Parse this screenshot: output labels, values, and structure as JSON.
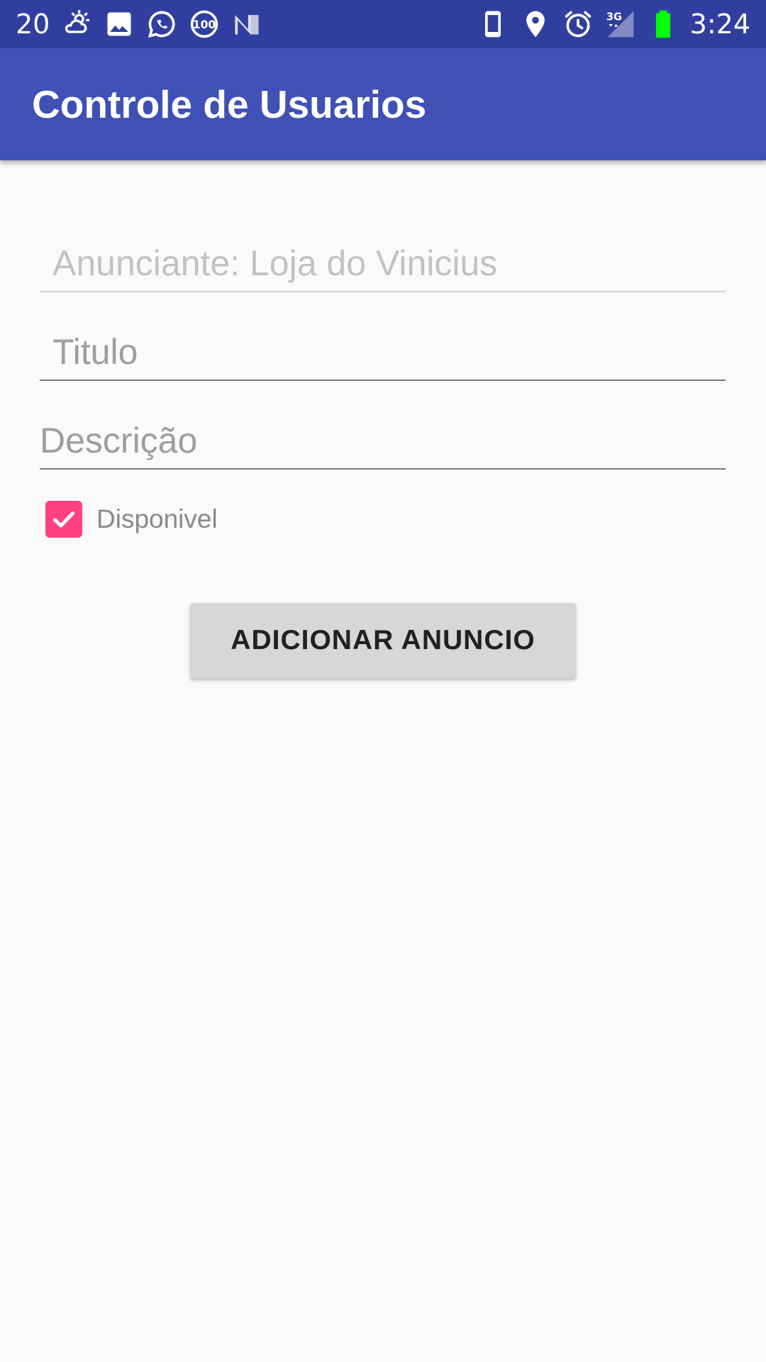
{
  "status_bar": {
    "left_number": "20",
    "left_icons": [
      "cloud-sun-icon",
      "gallery-image-icon",
      "whatsapp-icon",
      "hundred-badge-icon",
      "n-logo-icon"
    ],
    "right_icons": [
      "phone-vibrate-icon",
      "location-pin-icon",
      "alarm-icon",
      "signal-3g-icon",
      "battery-icon"
    ],
    "network_label": "3G",
    "time": "3:24",
    "colors": {
      "background": "#303f9f",
      "battery": "#00ff00"
    }
  },
  "app_bar": {
    "title": "Controle de Usuarios",
    "color": "#3f51b5"
  },
  "form": {
    "anunciante": {
      "value": "Anunciante: Loja do Vinicius"
    },
    "titulo": {
      "placeholder": "Titulo"
    },
    "descricao": {
      "placeholder": "Descrição"
    },
    "disponivel": {
      "label": "Disponivel",
      "checked": true,
      "color": "#ff4081"
    },
    "submit_label": "ADICIONAR ANUNCIO"
  }
}
